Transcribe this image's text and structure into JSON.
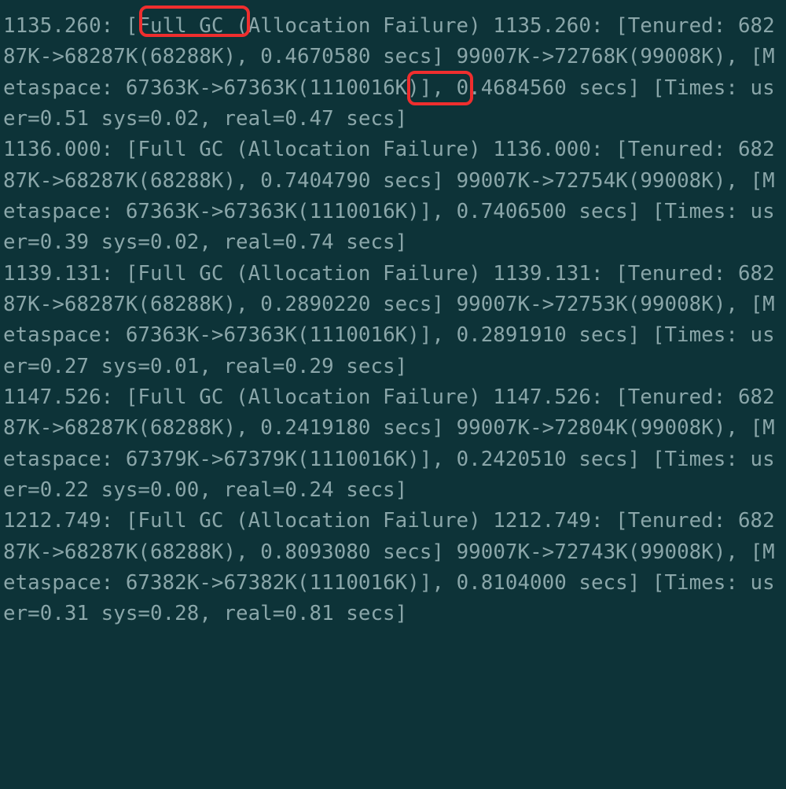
{
  "gc_log": {
    "entries": [
      {
        "timestamp": "1135.260",
        "event": "Full GC",
        "cause": "Allocation Failure",
        "inner_timestamp": "1135.260",
        "tenured_before": "68287K",
        "tenured_after": "68287K",
        "tenured_total": "68288K",
        "tenured_secs": "0.4670580",
        "heap_before": "99007K",
        "heap_after": "72768K",
        "heap_total": "99008K",
        "metaspace_before": "67363K",
        "metaspace_after": "67363K",
        "metaspace_total": "1110016K",
        "total_secs": "0.4684560",
        "times_user": "0.51",
        "times_sys": "0.02",
        "times_real": "0.47"
      },
      {
        "timestamp": "1136.000",
        "event": "Full GC",
        "cause": "Allocation Failure",
        "inner_timestamp": "1136.000",
        "tenured_before": "68287K",
        "tenured_after": "68287K",
        "tenured_total": "68288K",
        "tenured_secs": "0.7404790",
        "heap_before": "99007K",
        "heap_after": "72754K",
        "heap_total": "99008K",
        "metaspace_before": "67363K",
        "metaspace_after": "67363K",
        "metaspace_total": "1110016K",
        "total_secs": "0.7406500",
        "times_user": "0.39",
        "times_sys": "0.02",
        "times_real": "0.74"
      },
      {
        "timestamp": "1139.131",
        "event": "Full GC",
        "cause": "Allocation Failure",
        "inner_timestamp": "1139.131",
        "tenured_before": "68287K",
        "tenured_after": "68287K",
        "tenured_total": "68288K",
        "tenured_secs": "0.2890220",
        "heap_before": "99007K",
        "heap_after": "72753K",
        "heap_total": "99008K",
        "metaspace_before": "67363K",
        "metaspace_after": "67363K",
        "metaspace_total": "1110016K",
        "total_secs": "0.2891910",
        "times_user": "0.27",
        "times_sys": "0.01",
        "times_real": "0.29"
      },
      {
        "timestamp": "1147.526",
        "event": "Full GC",
        "cause": "Allocation Failure",
        "inner_timestamp": "1147.526",
        "tenured_before": "68287K",
        "tenured_after": "68287K",
        "tenured_total": "68288K",
        "tenured_secs": "0.2419180",
        "heap_before": "99007K",
        "heap_after": "72804K",
        "heap_total": "99008K",
        "metaspace_before": "67379K",
        "metaspace_after": "67379K",
        "metaspace_total": "1110016K",
        "total_secs": "0.2420510",
        "times_user": "0.22",
        "times_sys": "0.00",
        "times_real": "0.24"
      },
      {
        "timestamp": "1212.749",
        "event": "Full GC",
        "cause": "Allocation Failure",
        "inner_timestamp": "1212.749",
        "tenured_before": "68287K",
        "tenured_after": "68287K",
        "tenured_total": "68288K",
        "tenured_secs": "0.8093080",
        "heap_before": "99007K",
        "heap_after": "72743K",
        "heap_total": "99008K",
        "metaspace_before": "67382K",
        "metaspace_after": "67382K",
        "metaspace_total": "1110016K",
        "total_secs": "0.8104000",
        "times_user": "0.31",
        "times_sys": "0.28",
        "times_real": "0.81"
      }
    ]
  },
  "highlights": [
    {
      "name": "highlight-full-gc",
      "target_text": "Full GC"
    },
    {
      "name": "highlight-user-time",
      "target_text": "0.51"
    }
  ]
}
